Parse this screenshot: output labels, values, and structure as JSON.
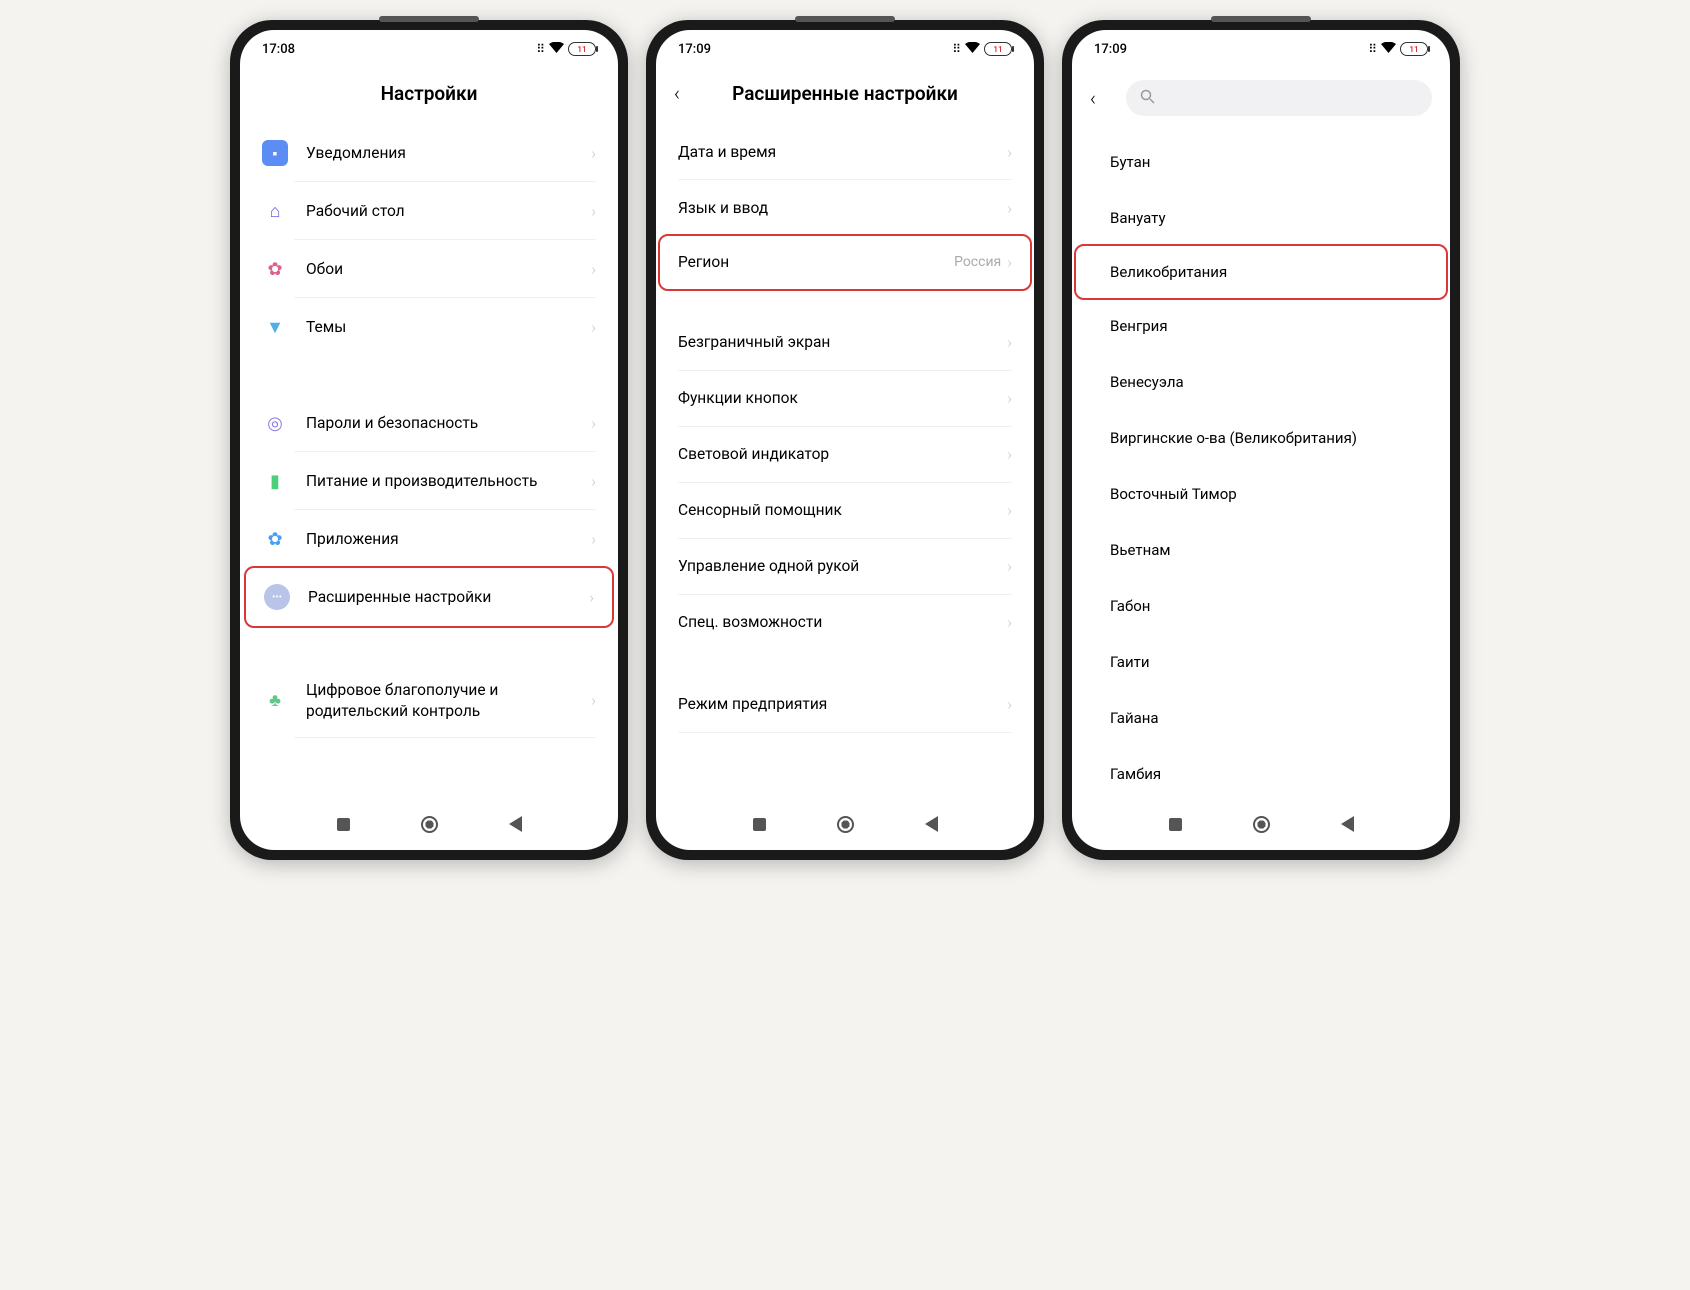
{
  "status": {
    "time1": "17:08",
    "time2": "17:09",
    "time3": "17:09",
    "battery": "11"
  },
  "phone1": {
    "title": "Настройки",
    "group1": [
      {
        "label": "Уведомления"
      },
      {
        "label": "Рабочий стол"
      },
      {
        "label": "Обои"
      },
      {
        "label": "Темы"
      }
    ],
    "group2": [
      {
        "label": "Пароли и безопасность"
      },
      {
        "label": "Питание и производительность"
      },
      {
        "label": "Приложения"
      },
      {
        "label": "Расширенные настройки"
      }
    ],
    "group3": [
      {
        "label": "Цифровое благополучие и родительский контроль"
      }
    ]
  },
  "phone2": {
    "title": "Расширенные настройки",
    "group1": [
      {
        "label": "Дата и время"
      },
      {
        "label": "Язык и ввод"
      },
      {
        "label": "Регион",
        "value": "Россия"
      }
    ],
    "group2": [
      {
        "label": "Безграничный экран"
      },
      {
        "label": "Функции кнопок"
      },
      {
        "label": "Световой индикатор"
      },
      {
        "label": "Сенсорный помощник"
      },
      {
        "label": "Управление одной рукой"
      },
      {
        "label": "Спец. возможности"
      }
    ],
    "group3": [
      {
        "label": "Режим предприятия"
      }
    ]
  },
  "phone3": {
    "countries": [
      "Бутан",
      "Вануату",
      "Великобритания",
      "Венгрия",
      "Венесуэла",
      "Виргинские о-ва (Великобритания)",
      "Восточный Тимор",
      "Вьетнам",
      "Габон",
      "Гаити",
      "Гайана",
      "Гамбия"
    ],
    "highlight_index": 2
  }
}
